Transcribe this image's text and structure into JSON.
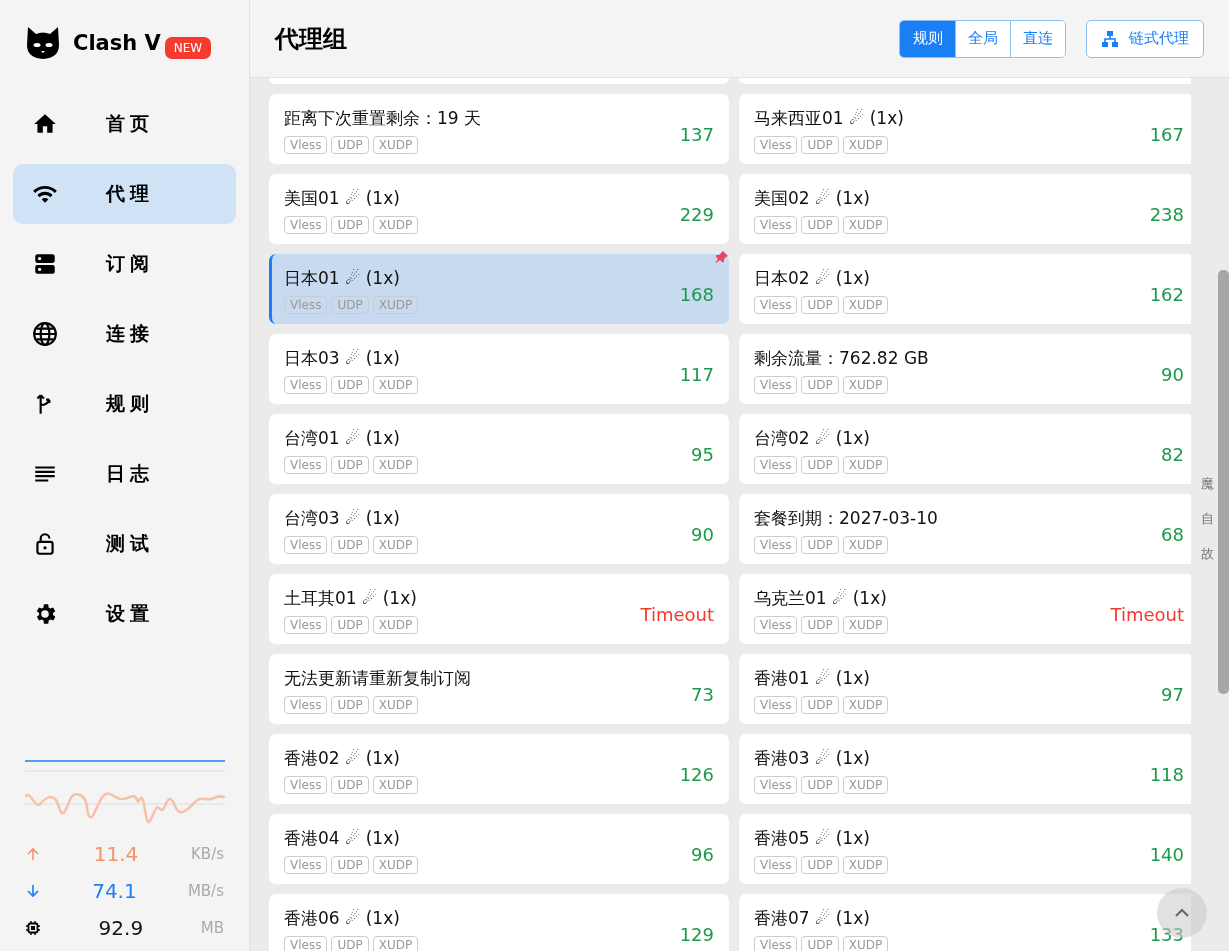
{
  "app": {
    "name": "Clash V",
    "badge": "NEW"
  },
  "nav": [
    {
      "label": "首页",
      "selected": false
    },
    {
      "label": "代理",
      "selected": true
    },
    {
      "label": "订阅",
      "selected": false
    },
    {
      "label": "连接",
      "selected": false
    },
    {
      "label": "规则",
      "selected": false
    },
    {
      "label": "日志",
      "selected": false
    },
    {
      "label": "测试",
      "selected": false
    },
    {
      "label": "设置",
      "selected": false
    }
  ],
  "traffic": [
    {
      "kind": "up",
      "value": "11.4",
      "unit": "KB/s"
    },
    {
      "kind": "down",
      "value": "74.1",
      "unit": "MB/s"
    },
    {
      "kind": "memory",
      "value": "92.9",
      "unit": "MB"
    }
  ],
  "header": {
    "title": "代理组",
    "modes": [
      {
        "label": "规则",
        "selected": true
      },
      {
        "label": "全局",
        "selected": false
      },
      {
        "label": "直连",
        "selected": false
      }
    ],
    "chain_button": "链式代理"
  },
  "proxies": [
    {
      "name": "距离下次重置剩余：19 天",
      "tags": [
        "Vless",
        "UDP",
        "XUDP"
      ],
      "delay": "137",
      "kind": "latency",
      "selected": false,
      "pinned": false
    },
    {
      "name": "马来西亚01 ☄ (1x)",
      "tags": [
        "Vless",
        "UDP",
        "XUDP"
      ],
      "delay": "167",
      "kind": "latency",
      "selected": false,
      "pinned": false
    },
    {
      "name": "美国01 ☄ (1x)",
      "tags": [
        "Vless",
        "UDP",
        "XUDP"
      ],
      "delay": "229",
      "kind": "latency",
      "selected": false,
      "pinned": false
    },
    {
      "name": "美国02 ☄ (1x)",
      "tags": [
        "Vless",
        "UDP",
        "XUDP"
      ],
      "delay": "238",
      "kind": "latency",
      "selected": false,
      "pinned": false
    },
    {
      "name": "日本01 ☄ (1x)",
      "tags": [
        "Vless",
        "UDP",
        "XUDP"
      ],
      "delay": "168",
      "kind": "latency",
      "selected": true,
      "pinned": true
    },
    {
      "name": "日本02 ☄ (1x)",
      "tags": [
        "Vless",
        "UDP",
        "XUDP"
      ],
      "delay": "162",
      "kind": "latency",
      "selected": false,
      "pinned": false
    },
    {
      "name": "日本03 ☄ (1x)",
      "tags": [
        "Vless",
        "UDP",
        "XUDP"
      ],
      "delay": "117",
      "kind": "latency",
      "selected": false,
      "pinned": false
    },
    {
      "name": "剩余流量：762.82 GB",
      "tags": [
        "Vless",
        "UDP",
        "XUDP"
      ],
      "delay": "90",
      "kind": "latency",
      "selected": false,
      "pinned": false
    },
    {
      "name": "台湾01 ☄ (1x)",
      "tags": [
        "Vless",
        "UDP",
        "XUDP"
      ],
      "delay": "95",
      "kind": "latency",
      "selected": false,
      "pinned": false
    },
    {
      "name": "台湾02 ☄ (1x)",
      "tags": [
        "Vless",
        "UDP",
        "XUDP"
      ],
      "delay": "82",
      "kind": "latency",
      "selected": false,
      "pinned": false
    },
    {
      "name": "台湾03 ☄ (1x)",
      "tags": [
        "Vless",
        "UDP",
        "XUDP"
      ],
      "delay": "90",
      "kind": "latency",
      "selected": false,
      "pinned": false
    },
    {
      "name": "套餐到期：2027-03-10",
      "tags": [
        "Vless",
        "UDP",
        "XUDP"
      ],
      "delay": "68",
      "kind": "latency",
      "selected": false,
      "pinned": false
    },
    {
      "name": "土耳其01 ☄ (1x)",
      "tags": [
        "Vless",
        "UDP",
        "XUDP"
      ],
      "delay": "Timeout",
      "kind": "timeout",
      "selected": false,
      "pinned": false
    },
    {
      "name": "乌克兰01 ☄ (1x)",
      "tags": [
        "Vless",
        "UDP",
        "XUDP"
      ],
      "delay": "Timeout",
      "kind": "timeout",
      "selected": false,
      "pinned": false
    },
    {
      "name": "无法更新请重新复制订阅",
      "tags": [
        "Vless",
        "UDP",
        "XUDP"
      ],
      "delay": "73",
      "kind": "latency",
      "selected": false,
      "pinned": false
    },
    {
      "name": "香港01 ☄ (1x)",
      "tags": [
        "Vless",
        "UDP",
        "XUDP"
      ],
      "delay": "97",
      "kind": "latency",
      "selected": false,
      "pinned": false
    },
    {
      "name": "香港02 ☄ (1x)",
      "tags": [
        "Vless",
        "UDP",
        "XUDP"
      ],
      "delay": "126",
      "kind": "latency",
      "selected": false,
      "pinned": false
    },
    {
      "name": "香港03 ☄ (1x)",
      "tags": [
        "Vless",
        "UDP",
        "XUDP"
      ],
      "delay": "118",
      "kind": "latency",
      "selected": false,
      "pinned": false
    },
    {
      "name": "香港04 ☄ (1x)",
      "tags": [
        "Vless",
        "UDP",
        "XUDP"
      ],
      "delay": "96",
      "kind": "latency",
      "selected": false,
      "pinned": false
    },
    {
      "name": "香港05 ☄ (1x)",
      "tags": [
        "Vless",
        "UDP",
        "XUDP"
      ],
      "delay": "140",
      "kind": "latency",
      "selected": false,
      "pinned": false
    },
    {
      "name": "香港06 ☄ (1x)",
      "tags": [
        "Vless",
        "UDP",
        "XUDP"
      ],
      "delay": "129",
      "kind": "latency",
      "selected": false,
      "pinned": false
    },
    {
      "name": "香港07 ☄ (1x)",
      "tags": [
        "Vless",
        "UDP",
        "XUDP"
      ],
      "delay": "133",
      "kind": "latency",
      "selected": false,
      "pinned": false
    }
  ],
  "index_letters": [
    "魔",
    "自",
    "故"
  ]
}
